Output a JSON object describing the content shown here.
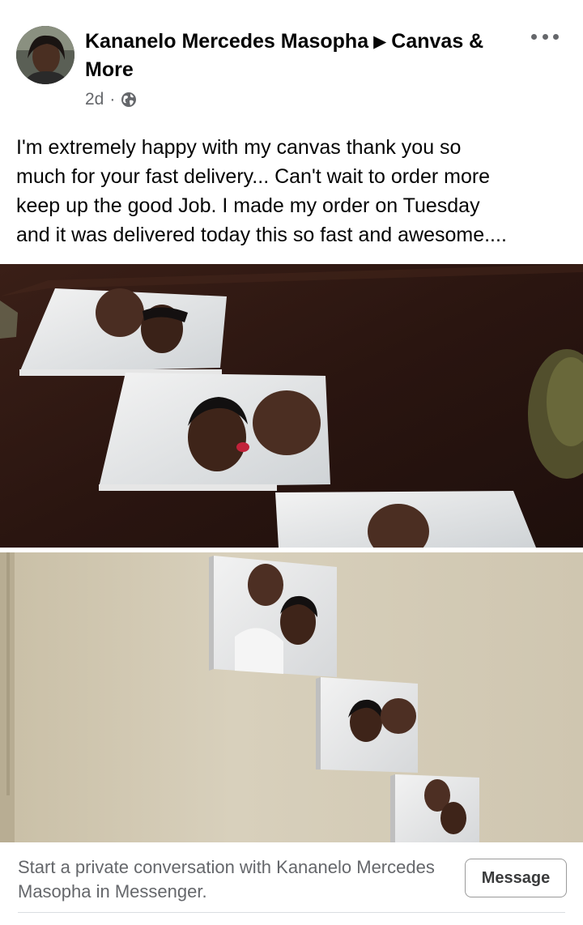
{
  "post": {
    "author": "Kananelo Mercedes Masopha",
    "group": "Canvas & More",
    "time": "2d",
    "separator": "·",
    "privacy_icon": "globe-icon",
    "more_icon": "more-icon",
    "text": "I'm extremely happy with my canvas thank you so\nmuch for your fast delivery... Can't wait to order more\nkeep up the good Job. I made my order on Tuesday\nand it was delivered today this so fast and awesome...."
  },
  "footer": {
    "prompt": "Start a private conversation with Kananelo Mercedes Masopha in Messenger.",
    "message_label": "Message"
  },
  "colors": {
    "text_primary": "#050505",
    "text_secondary": "#65676b",
    "divider": "#dadde1"
  }
}
